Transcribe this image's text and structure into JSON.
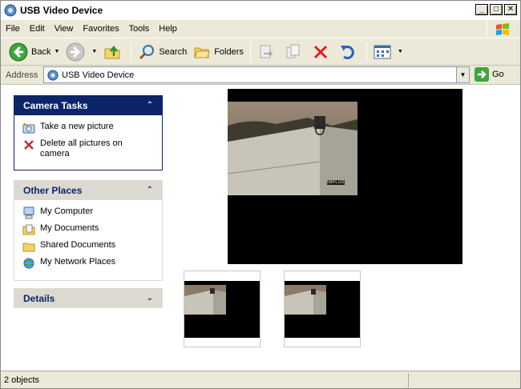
{
  "window": {
    "title": "USB Video Device"
  },
  "menu": [
    "File",
    "Edit",
    "View",
    "Favorites",
    "Tools",
    "Help"
  ],
  "toolbar": {
    "back_label": "Back",
    "search_label": "Search",
    "folders_label": "Folders"
  },
  "address": {
    "label": "Address",
    "value": "USB Video Device",
    "go_label": "Go"
  },
  "camera_tasks": {
    "title": "Camera Tasks",
    "items": [
      "Take a new picture",
      "Delete all pictures on camera"
    ]
  },
  "other_places": {
    "title": "Other Places",
    "items": [
      "My Computer",
      "My Documents",
      "Shared Documents",
      "My Network Places"
    ]
  },
  "details": {
    "title": "Details"
  },
  "preview": {
    "watermark": "IMPLUG"
  },
  "status": {
    "text": "2 objects"
  },
  "colors": {
    "pane_header_dark": "#0c246a",
    "pane_header_light": "#dcdad0",
    "chrome": "#ece9d8"
  }
}
